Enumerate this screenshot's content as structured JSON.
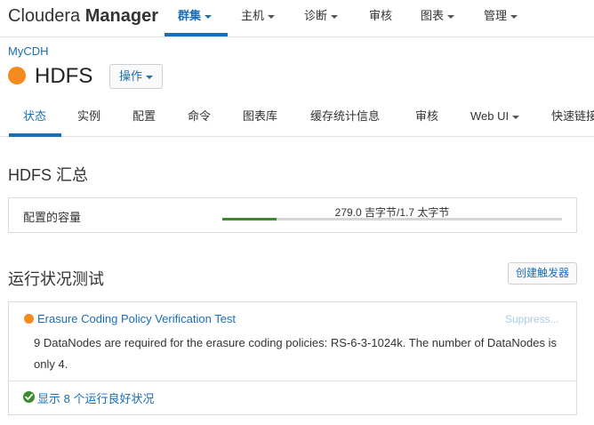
{
  "topnav": {
    "brand_light": "Cloudera",
    "brand_bold": "Manager",
    "items": [
      {
        "label": "群集",
        "dropdown": true,
        "active": true
      },
      {
        "label": "主机",
        "dropdown": true
      },
      {
        "label": "诊断",
        "dropdown": true
      },
      {
        "label": "审核",
        "dropdown": false
      },
      {
        "label": "图表",
        "dropdown": true
      },
      {
        "label": "管理",
        "dropdown": true
      }
    ]
  },
  "breadcrumb": "MyCDH",
  "service": {
    "name": "HDFS",
    "status_color": "#f58a1f",
    "actions_label": "操作"
  },
  "tabs": [
    {
      "label": "状态",
      "active": true
    },
    {
      "label": "实例"
    },
    {
      "label": "配置"
    },
    {
      "label": "命令"
    },
    {
      "label": "图表库"
    },
    {
      "label": "缓存统计信息"
    },
    {
      "label": "审核"
    },
    {
      "label": "Web UI",
      "dropdown": true
    },
    {
      "label": "快速链接"
    }
  ],
  "summary": {
    "title": "HDFS 汇总",
    "capacity_label": "配置的容量",
    "capacity_text": "279.0 吉字节/1.7 太字节",
    "capacity_fraction": 0.16
  },
  "health": {
    "title": "运行状况测试",
    "create_trigger": "创建触发器",
    "test": {
      "name": "Erasure Coding Policy Verification Test",
      "suppress": "Suppress...",
      "description": "9 DataNodes are required for the erasure coding policies: RS-6-3-1024k. The number of DataNodes is only 4.",
      "status_color": "#f58a1f"
    },
    "good_link": "显示 8 个运行良好状况"
  },
  "colors": {
    "accent": "#1a6eb5",
    "warning": "#f58a1f",
    "good": "#3d8b2e"
  }
}
